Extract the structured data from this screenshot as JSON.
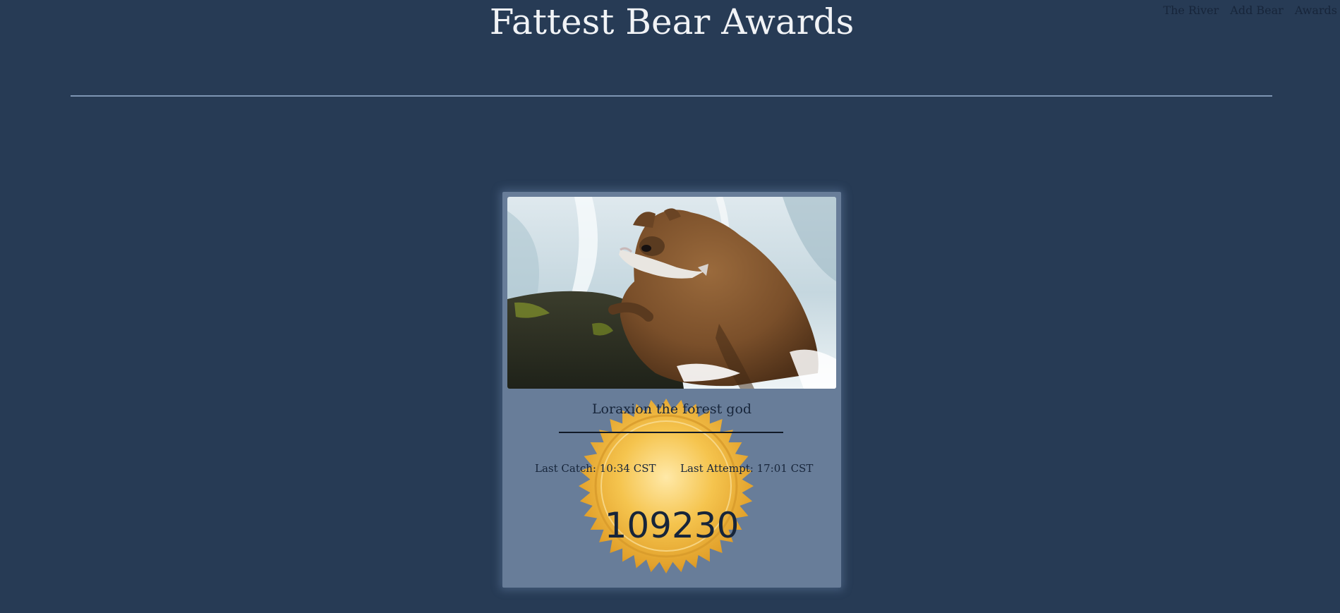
{
  "nav": {
    "items": [
      {
        "label": "The River"
      },
      {
        "label": "Add Bear"
      },
      {
        "label": "Awards"
      }
    ]
  },
  "header": {
    "title": "Fattest Bear Awards"
  },
  "award_card": {
    "bear_name": "Loraxion the forest god",
    "last_catch": "Last Catch: 10:34 CST",
    "last_attempt": "Last Attempt: 17:01 CST",
    "score": "109230",
    "seal_icon": "gold-award-seal-icon",
    "photo_subject": "brown-bear-with-salmon"
  },
  "colors": {
    "background": "#273b55",
    "card": "#687d99",
    "text_dark": "#17253a",
    "title": "#f1f3f6",
    "divider": "#7e95b3",
    "seal_gold": "#f0b93a"
  }
}
